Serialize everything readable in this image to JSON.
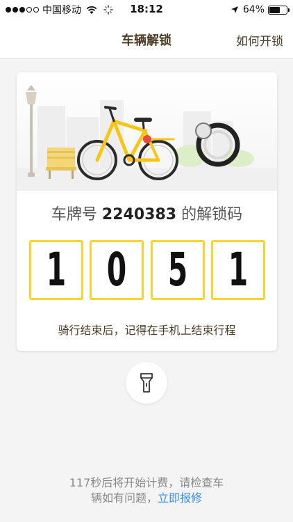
{
  "status_bar": {
    "carrier": "中国移动",
    "time": "18:12",
    "battery": "64%",
    "battery_level": 0.64
  },
  "nav": {
    "title": "车辆解锁",
    "action": "如何开锁"
  },
  "unlock": {
    "caption_prefix": "车牌号",
    "plate_number": "2240383",
    "caption_suffix": "的解锁码",
    "code": [
      "1",
      "0",
      "5",
      "1"
    ],
    "reminder": "骑行结束后，记得在手机上结束行程"
  },
  "footer": {
    "line1": "117秒后将开始计费，请检查车",
    "line2_prefix": "辆如有问题，",
    "repair_link": "立即报修"
  },
  "colors": {
    "accent_yellow": "#f7d531",
    "link_blue": "#3a8ee6",
    "title_brown": "#4a3b25"
  },
  "icons": [
    "wifi-icon",
    "spinner-icon",
    "location-arrow-icon",
    "battery-icon",
    "flashlight-icon",
    "bicycle-illustration"
  ]
}
